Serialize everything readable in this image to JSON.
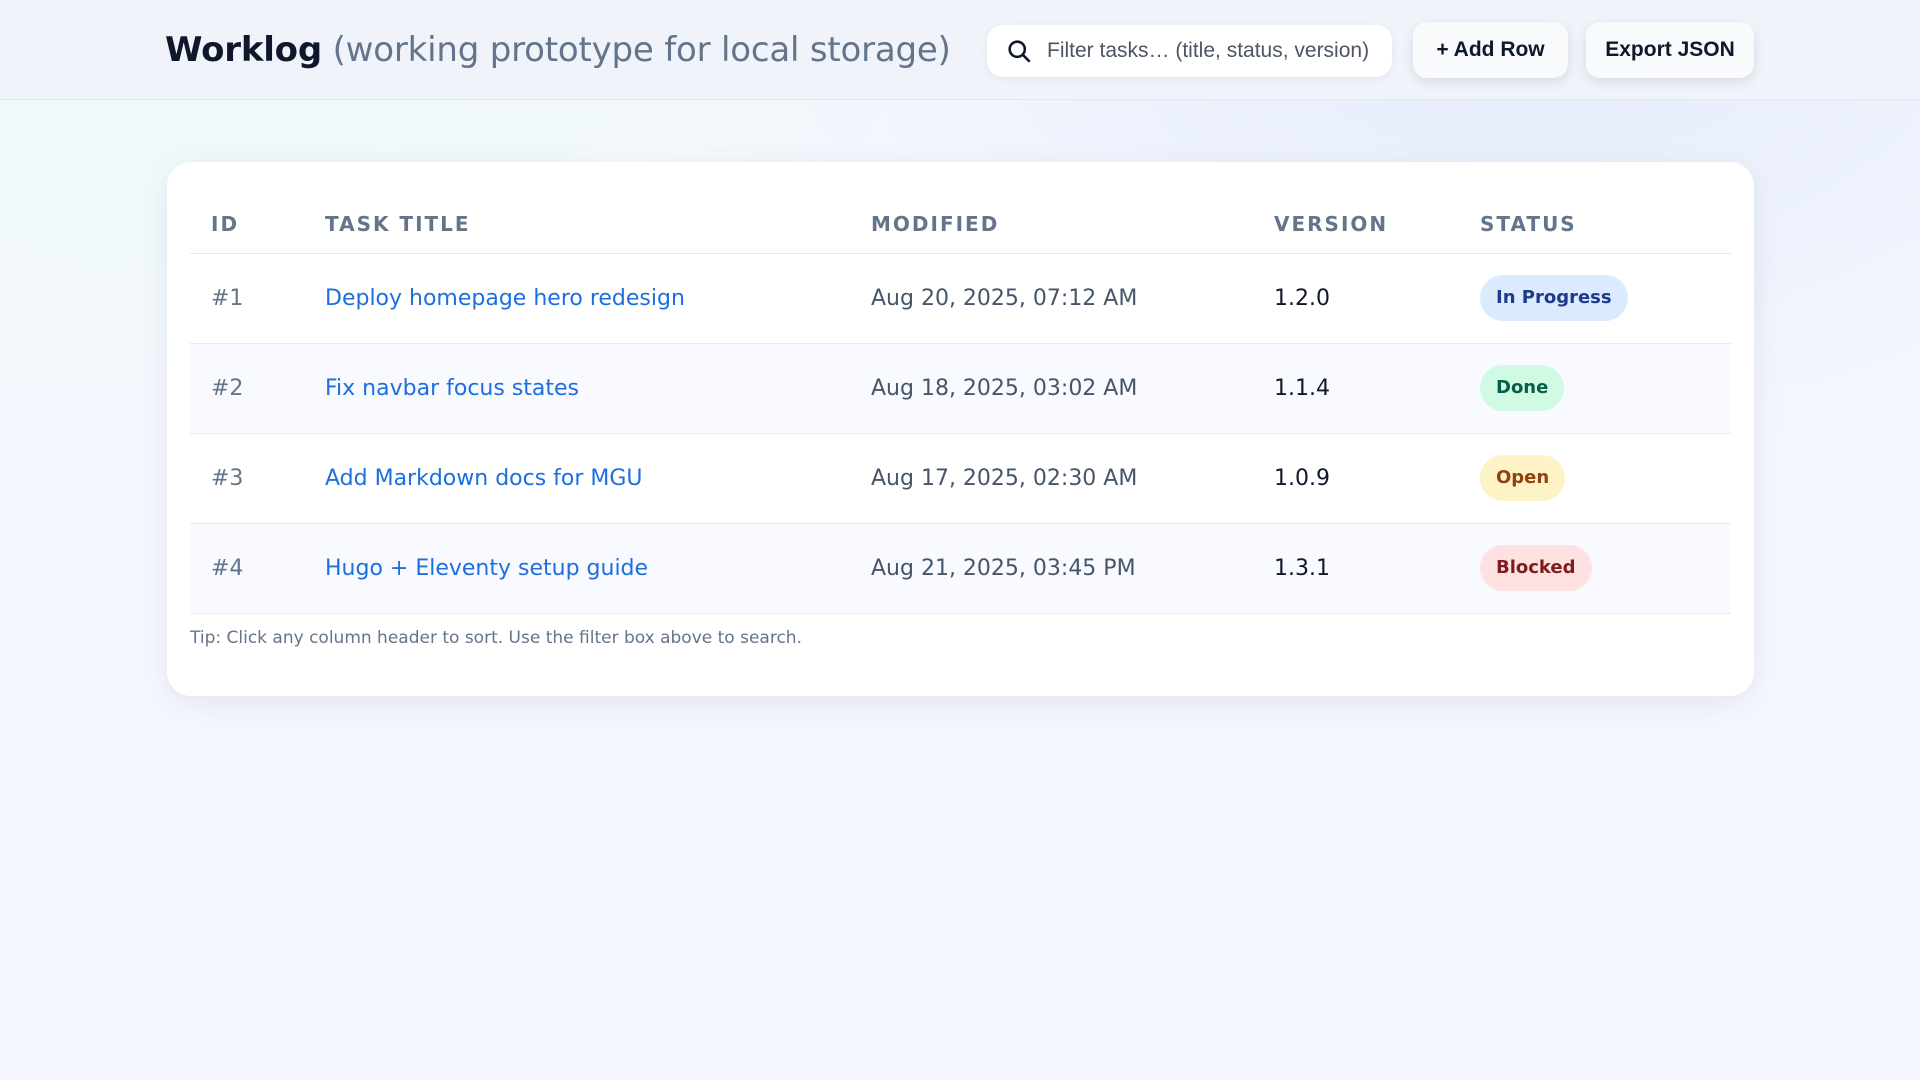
{
  "header": {
    "app_name": "Worklog",
    "subtitle": "(working prototype for local storage)",
    "search": {
      "placeholder": "Filter tasks… (title, status, version)",
      "value": "",
      "icon": "search-icon"
    },
    "add_row_label": "+ Add Row",
    "export_label": "Export JSON"
  },
  "table": {
    "columns": [
      "ID",
      "TASK TITLE",
      "MODIFIED",
      "VERSION",
      "STATUS"
    ],
    "rows": [
      {
        "id": "#1",
        "title": "Deploy homepage hero redesign",
        "modified": "Aug 20, 2025, 07:12 AM",
        "version": "1.2.0",
        "status": "In Progress"
      },
      {
        "id": "#2",
        "title": "Fix navbar focus states",
        "modified": "Aug 18, 2025, 03:02 AM",
        "version": "1.1.4",
        "status": "Done"
      },
      {
        "id": "#3",
        "title": "Add Markdown docs for MGU",
        "modified": "Aug 17, 2025, 02:30 AM",
        "version": "1.0.9",
        "status": "Open"
      },
      {
        "id": "#4",
        "title": "Hugo + Eleventy setup guide",
        "modified": "Aug 21, 2025, 03:45 PM",
        "version": "1.3.1",
        "status": "Blocked"
      }
    ]
  },
  "tip": "Tip: Click any column header to sort. Use the filter box above to search.",
  "colors": {
    "link": "#1d6fe0",
    "status_in_progress_bg": "#dbeafe",
    "status_in_progress_fg": "#1e3a8a",
    "status_done_bg": "#d1fae5",
    "status_done_fg": "#065f46",
    "status_open_bg": "#fef3c7",
    "status_open_fg": "#92400e",
    "status_blocked_bg": "#fee2e2",
    "status_blocked_fg": "#7f1d1d"
  }
}
